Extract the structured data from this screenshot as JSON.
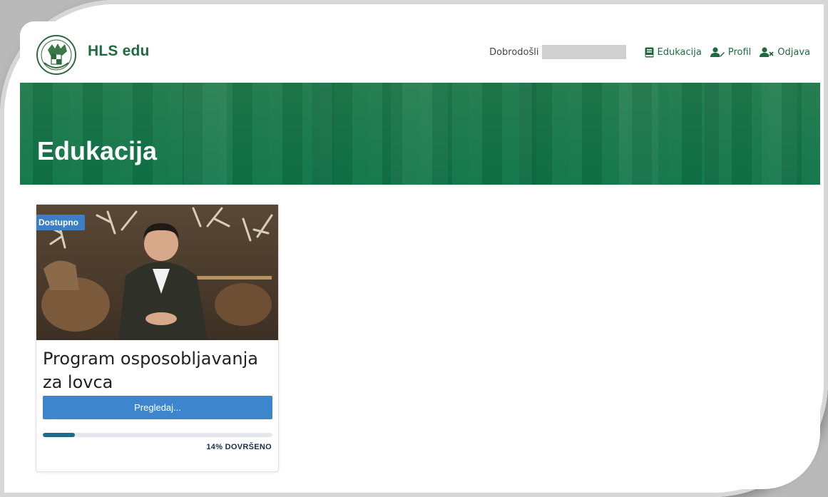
{
  "header": {
    "brand": "HLS edu",
    "welcome": "Dobrodošli",
    "nav": [
      {
        "label": "Edukacija",
        "icon": "book-icon"
      },
      {
        "label": "Profil",
        "icon": "user-edit-icon"
      },
      {
        "label": "Odjava",
        "icon": "user-remove-icon"
      }
    ]
  },
  "banner": {
    "title": "Edukacija"
  },
  "course": {
    "badge": "Dostupno",
    "title": "Program osposobljavanja za lovca",
    "button_label": "Pregledaj...",
    "progress": 14,
    "progress_label": "14% DOVRŠENO"
  },
  "colors": {
    "brand_green": "#1e6b3f",
    "banner_green": "#0f7448",
    "button_blue": "#3d86cd",
    "progress_fill": "#1d6d87"
  }
}
